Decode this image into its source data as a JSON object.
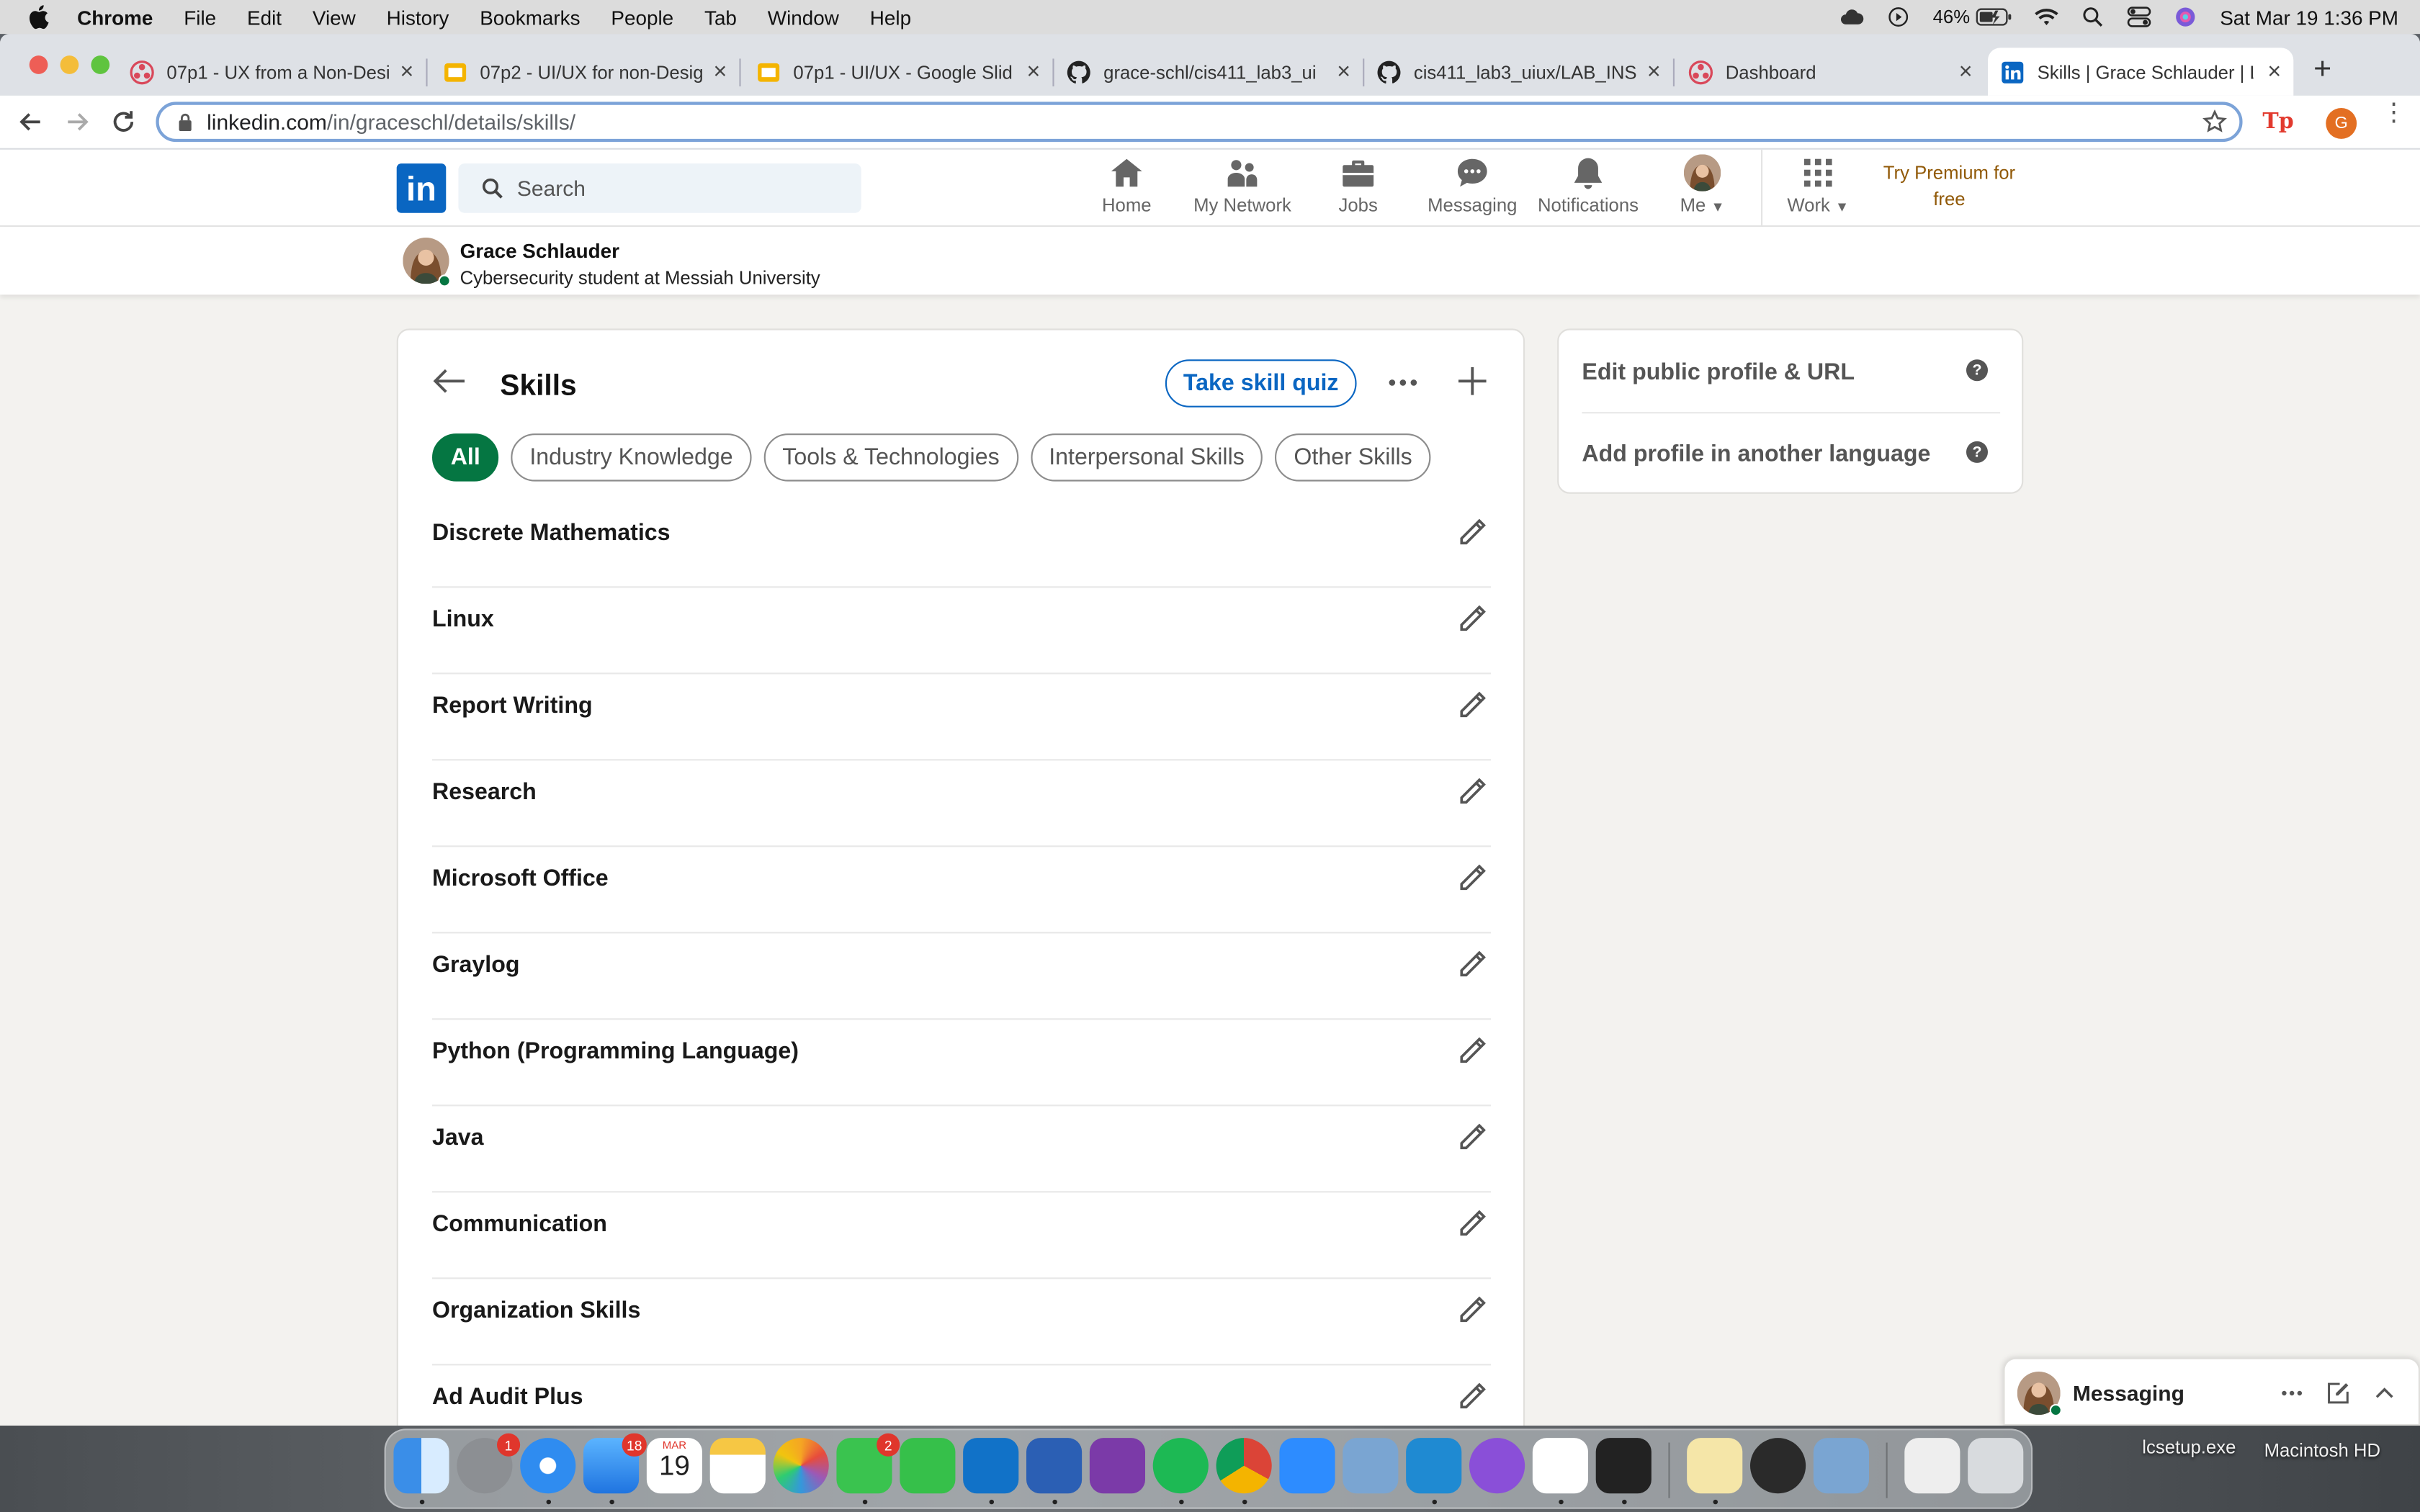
{
  "menubar": {
    "app": "Chrome",
    "items": [
      "File",
      "Edit",
      "View",
      "History",
      "Bookmarks",
      "People",
      "Tab",
      "Window",
      "Help"
    ],
    "battery": "46%",
    "datetime": "Sat Mar 19  1:36 PM"
  },
  "tabs": [
    {
      "title": "07p1 - UX from a Non-Desi",
      "icon": "asana-icon"
    },
    {
      "title": "07p2 - UI/UX for non-Desig",
      "icon": "slides-icon"
    },
    {
      "title": "07p1 - UI/UX - Google Slid",
      "icon": "slides-icon"
    },
    {
      "title": "grace-schl/cis411_lab3_ui",
      "icon": "github-icon"
    },
    {
      "title": "cis411_lab3_uiux/LAB_INS",
      "icon": "github-icon"
    },
    {
      "title": "Dashboard",
      "icon": "asana-icon"
    },
    {
      "title": "Skills | Grace Schlauder | L",
      "icon": "linkedin-icon"
    }
  ],
  "omnibox": {
    "host": "linkedin.com",
    "path": "/in/graceschl/details/skills/"
  },
  "profile_initial": "G",
  "linkedin": {
    "logo": "in",
    "search_placeholder": "Search",
    "nav": {
      "home": "Home",
      "network": "My Network",
      "jobs": "Jobs",
      "messaging": "Messaging",
      "notifications": "Notifications",
      "me": "Me",
      "work": "Work"
    },
    "premium": "Try Premium for free"
  },
  "profile": {
    "name": "Grace Schlauder",
    "headline": "Cybersecurity student at Messiah University"
  },
  "skills_card": {
    "title": "Skills",
    "quiz_button": "Take skill quiz",
    "filters": [
      "All",
      "Industry Knowledge",
      "Tools & Technologies",
      "Interpersonal Skills",
      "Other Skills"
    ],
    "skills": [
      "Discrete Mathematics",
      "Linux",
      "Report Writing",
      "Research",
      "Microsoft Office",
      "Graylog",
      "Python (Programming Language)",
      "Java",
      "Communication",
      "Organization Skills",
      "Ad Audit Plus"
    ]
  },
  "side_card": {
    "edit_profile": "Edit public profile & URL",
    "add_language": "Add profile in another language"
  },
  "messaging": {
    "title": "Messaging"
  },
  "dock": {
    "badges": {
      "system_prefs": "1",
      "mail": "18",
      "messages": "2"
    },
    "calendar_month": "MAR",
    "calendar_day": "19"
  },
  "desktop": {
    "file_label": "lcsetup.exe",
    "disk_label": "Macintosh HD"
  }
}
